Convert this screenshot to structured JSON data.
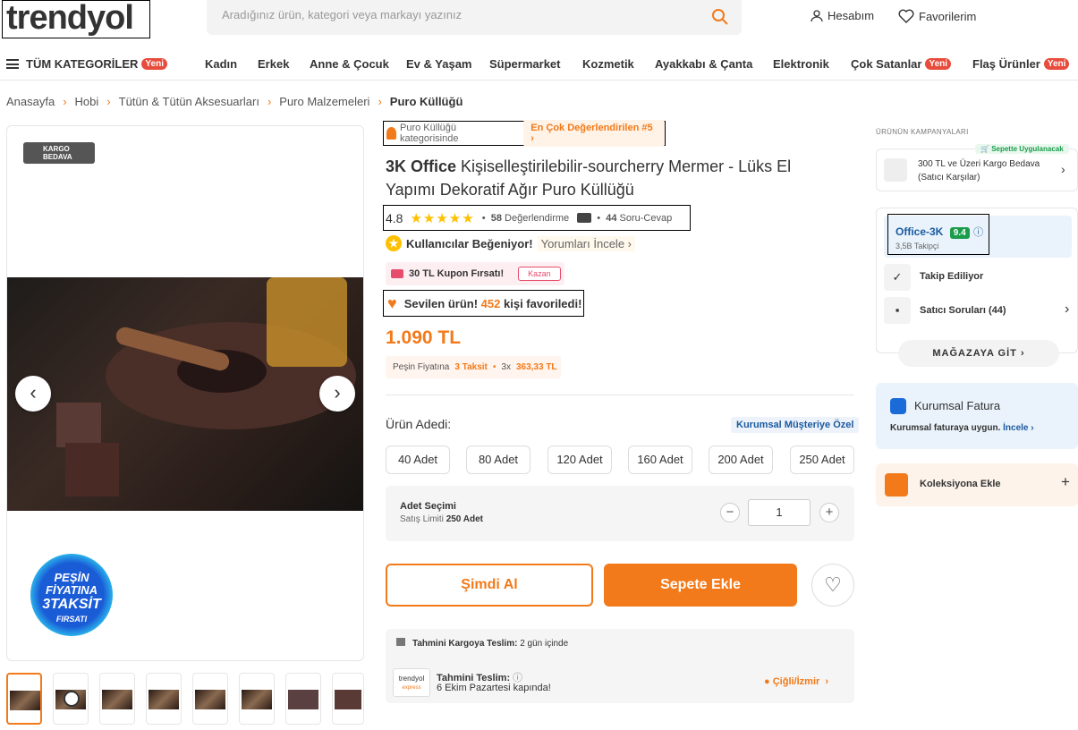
{
  "header": {
    "logo": "trendyol",
    "search_placeholder": "Aradığınız ürün, kategori veya markayı yazınız",
    "account": "Hesabım",
    "favorites": "Favorilerim"
  },
  "categories": {
    "all": "TÜM KATEGORİLER",
    "new_badge": "Yeni",
    "items": [
      "Kadın",
      "Erkek",
      "Anne & Çocuk",
      "Ev & Yaşam",
      "Süpermarket",
      "Kozmetik",
      "Ayakkabı & Çanta",
      "Elektronik",
      "Çok Satanlar",
      "Flaş Ürünler"
    ]
  },
  "breadcrumb": [
    "Anasayfa",
    "Hobi",
    "Tütün & Tütün Aksesuarları",
    "Puro Malzemeleri",
    "Puro Küllüğü"
  ],
  "gallery": {
    "kargo_badge_1": "KARGO",
    "kargo_badge_2": "BEDAVA",
    "campaign_1": "PEŞİN",
    "campaign_2": "FİYATINA",
    "campaign_3": "3TAKSİT",
    "campaign_4": "FIRSATI"
  },
  "product": {
    "category_text": "Puro Küllüğü kategorisinde",
    "category_rank": "En Çok Değerlendirilen #5",
    "brand": "3K Office",
    "name": "Kişiselleştirilebilir-sourcherry Mermer - Lüks El Yapımı Dekoratif Ağır Puro Küllüğü",
    "rating": "4.8",
    "rating_count": "58",
    "rating_label": "Değerlendirme",
    "qa_count": "44",
    "qa_label": "Soru-Cevap",
    "liked_text": "Kullanıcılar Beğeniyor!",
    "liked_link": "Yorumları İncele",
    "coupon": "30 TL Kupon Fırsatı!",
    "coupon_btn": "Kazan",
    "fav_1": "Sevilen ürün!",
    "fav_count": "452",
    "fav_2": "kişi favoriledi!",
    "price": "1.090 TL",
    "taksit_1": "Peşin Fiyatına",
    "taksit_2": "3 Taksit",
    "taksit_3": "3x",
    "taksit_4": "363,33 TL"
  },
  "quantity": {
    "label": "Ürün Adedi:",
    "corporate": "Kurumsal Müşteriye Özel",
    "options": [
      "40 Adet",
      "80 Adet",
      "120 Adet",
      "160 Adet",
      "200 Adet",
      "250 Adet"
    ],
    "select_title": "Adet Seçimi",
    "limit_label": "Satış Limiti",
    "limit_value": "250 Adet",
    "value": "1"
  },
  "actions": {
    "buy": "Şimdi Al",
    "cart": "Sepete Ekle"
  },
  "shipping": {
    "cargo_label": "Tahmini Kargoya Teslim:",
    "cargo_value": "2 gün içinde",
    "delivery_label": "Tahmini Teslim:",
    "delivery_value": "6 Ekim Pazartesi kapında!",
    "location": "Çiğli/İzmir",
    "logo_1": "trendyol",
    "logo_2": "express"
  },
  "sidebar": {
    "campaigns_title": "ÜRÜNÜN KAMPANYALARI",
    "applied": "Sepette Uygulanacak",
    "campaign_text": "300 TL ve Üzeri Kargo Bedava (Satıcı Karşılar)",
    "seller_name": "Office-3K",
    "seller_score": "9.4",
    "followers": "3,5B Takipçi",
    "following": "Takip Ediliyor",
    "questions": "Satıcı Soruları (44)",
    "store_btn": "MAĞAZAYA GİT",
    "corp_title": "Kurumsal Fatura",
    "corp_text": "Kurumsal faturaya uygun.",
    "corp_link": "İncele",
    "collection": "Koleksiyona Ekle"
  }
}
